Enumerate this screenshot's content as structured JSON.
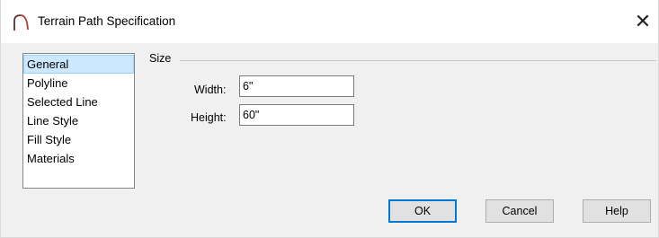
{
  "window": {
    "title": "Terrain Path Specification",
    "icon": "terrain-path-icon",
    "close_glyph": "✕"
  },
  "sidebar": {
    "items": [
      {
        "label": "General",
        "selected": true
      },
      {
        "label": "Polyline",
        "selected": false
      },
      {
        "label": "Selected Line",
        "selected": false
      },
      {
        "label": "Line Style",
        "selected": false
      },
      {
        "label": "Fill Style",
        "selected": false
      },
      {
        "label": "Materials",
        "selected": false
      }
    ]
  },
  "size_group": {
    "label": "Size",
    "width_label": "Width:",
    "width_value": "6\"",
    "height_label": "Height:",
    "height_value": "60\""
  },
  "buttons": {
    "ok": "OK",
    "cancel": "Cancel",
    "help": "Help"
  },
  "colors": {
    "selection_bg": "#cce8ff",
    "default_button_border": "#0078d7",
    "icon_stroke": "#c0392b"
  }
}
